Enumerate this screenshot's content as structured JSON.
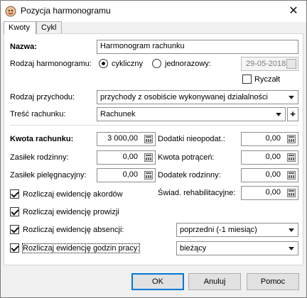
{
  "window": {
    "title": "Pozycja harmonogramu"
  },
  "tabs": [
    {
      "label": "Kwoty",
      "active": true
    },
    {
      "label": "Cykl",
      "active": false
    }
  ],
  "form": {
    "nazwa_label": "Nazwa:",
    "nazwa_value": "Harmonogram rachunku",
    "rodzaj_harmonogramu_label": "Rodzaj harmonogramu:",
    "opt_cykliczny": "cykliczny",
    "opt_jednorazowy": "jednorazowy:",
    "date_value": "29-05-2018",
    "ryczalt_label": "Ryczałt",
    "rodzaj_przychodu_label": "Rodzaj przychodu:",
    "rodzaj_przychodu_value": "przychody z osobiście wykonywanej działalności",
    "tresc_label": "Treść rachunku:",
    "tresc_value": "Rachunek",
    "plus_label": "+"
  },
  "amounts": {
    "kwota_label": "Kwota rachunku:",
    "kwota_value": "3 000,00",
    "zasilek_rodzinny_label": "Zasiłek rodzinny:",
    "zasilek_rodzinny_value": "0,00",
    "zasilek_piel_label": "Zasiłek pielęgnacyjny:",
    "zasilek_piel_value": "0,00",
    "dodatki_label": "Dodatki nieopodat.:",
    "dodatki_value": "0,00",
    "potracen_label": "Kwota potrąceń:",
    "potracen_value": "0,00",
    "dodatek_rodz_label": "Dodatek rodzinny:",
    "dodatek_rodz_value": "0,00",
    "swiad_label": "Świad. rehabilitacyjne:",
    "swiad_value": "0,00"
  },
  "checks": {
    "akordow": "Rozliczaj ewidencję akordów",
    "prowizji": "Rozliczaj ewidencję prowizji",
    "absencji": "Rozliczaj ewidencję absencji:",
    "absencji_select": "poprzedni (-1 miesiąc)",
    "godzin": "Rozliczaj ewidencję godzin pracy:",
    "godzin_select": "bieżący"
  },
  "buttons": {
    "ok": "OK",
    "cancel": "Anuluj",
    "help": "Pomoc"
  }
}
